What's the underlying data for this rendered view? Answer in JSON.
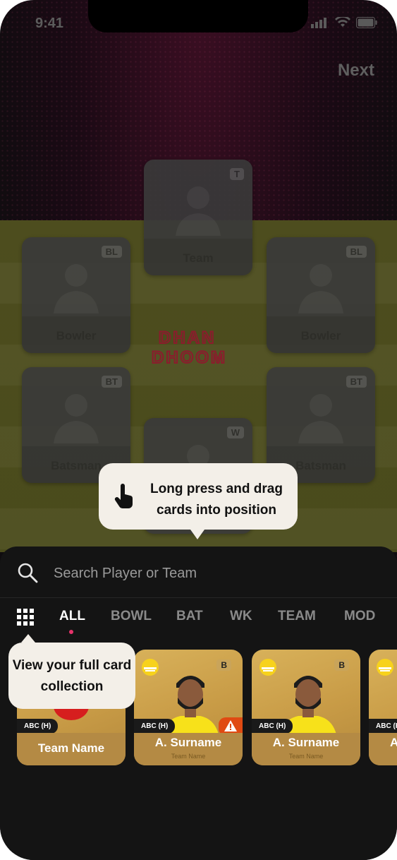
{
  "status": {
    "time": "9:41"
  },
  "header": {
    "next_label": "Next"
  },
  "formation": {
    "team_card": {
      "label": "Team",
      "badge": "T"
    },
    "bowler_left": {
      "label": "Bowler",
      "badge": "BL"
    },
    "bowler_right": {
      "label": "Bowler",
      "badge": "BL"
    },
    "batsman_left": {
      "label": "Batsman",
      "badge": "BT"
    },
    "batsman_right": {
      "label": "Batsman",
      "badge": "BT"
    },
    "wicket_card": {
      "badge": "W"
    }
  },
  "logo_text": {
    "line1": "DHAN",
    "line2": "DHOOM"
  },
  "drag_tip": {
    "text": "Long press and drag cards into position"
  },
  "search": {
    "placeholder": "Search Player or Team"
  },
  "tabs": [
    "ALL",
    "BOWL",
    "BAT",
    "WK",
    "TEAM",
    "MOD"
  ],
  "collection_tip": {
    "text": "View your full card collection"
  },
  "cards": [
    {
      "tag": "ABC (H)",
      "name": "Team Name"
    },
    {
      "tag": "ABC (H)",
      "name": "A. Surname",
      "team": "Team Name",
      "role": "B"
    },
    {
      "tag": "ABC (H)",
      "name": "A. Surname",
      "team": "Team Name",
      "role": "B"
    },
    {
      "tag": "ABC (H)",
      "name": "A"
    }
  ],
  "colors": {
    "accent": "#e8336b",
    "gold": "#c89b46",
    "sheet": "#141414"
  }
}
